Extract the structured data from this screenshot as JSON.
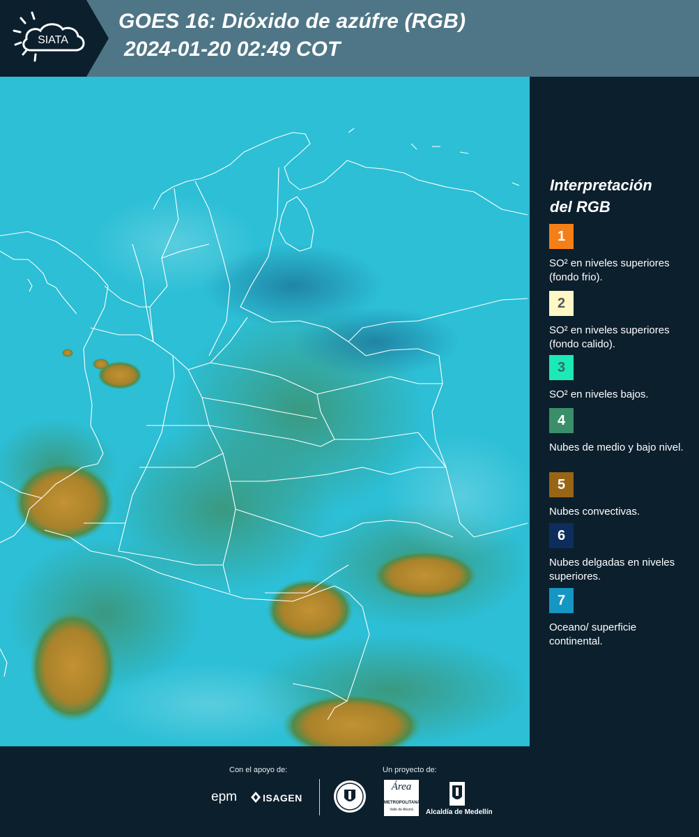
{
  "header": {
    "logo_text": "SIATA",
    "title": "GOES 16: Dióxido de azúfre (RGB)",
    "timestamp": "2024-01-20 02:49 COT"
  },
  "legend": {
    "title_line1": "Interpretación",
    "title_line2": "del RGB",
    "items": [
      {
        "number": "1",
        "color": "#f57f17",
        "text_color": "#ffffff",
        "description": "SO² en niveles superiores (fondo frio)."
      },
      {
        "number": "2",
        "color": "#fff8c4",
        "text_color": "#555555",
        "description": "SO² en niveles superiores (fondo calido)."
      },
      {
        "number": "3",
        "color": "#1de9b6",
        "text_color": "#2e6e62",
        "description": "SO² en niveles bajos."
      },
      {
        "number": "4",
        "color": "#3a8f6a",
        "text_color": "#ffffff",
        "description": "Nubes de medio y bajo nivel."
      },
      {
        "number": "5",
        "color": "#996515",
        "text_color": "#ffffff",
        "description": "Nubes convectivas."
      },
      {
        "number": "6",
        "color": "#0d2e5c",
        "text_color": "#ffffff",
        "description": "Nubes delgadas en niveles superiores."
      },
      {
        "number": "7",
        "color": "#1597c4",
        "text_color": "#ffffff",
        "description": "Oceano/ superficie continental."
      }
    ]
  },
  "footer": {
    "support_label": "Con el apoyo de:",
    "project_label": "Un proyecto de:",
    "epm_label": "epm",
    "isagen_label": "ISAGEN",
    "metro_label": "METROPOLITANA",
    "metro_sub": "Valle de Aburrá",
    "metro_script": "Área",
    "alcaldia_label": "Alcaldía de Medellín"
  },
  "colors": {
    "ocean": "#2ec4d8",
    "land": "#3aaebc",
    "convective": "#b3892b",
    "mid_low_cloud": "#3f9a76",
    "header_bg": "#4f7686",
    "panel_bg": "#0c1f2d"
  }
}
